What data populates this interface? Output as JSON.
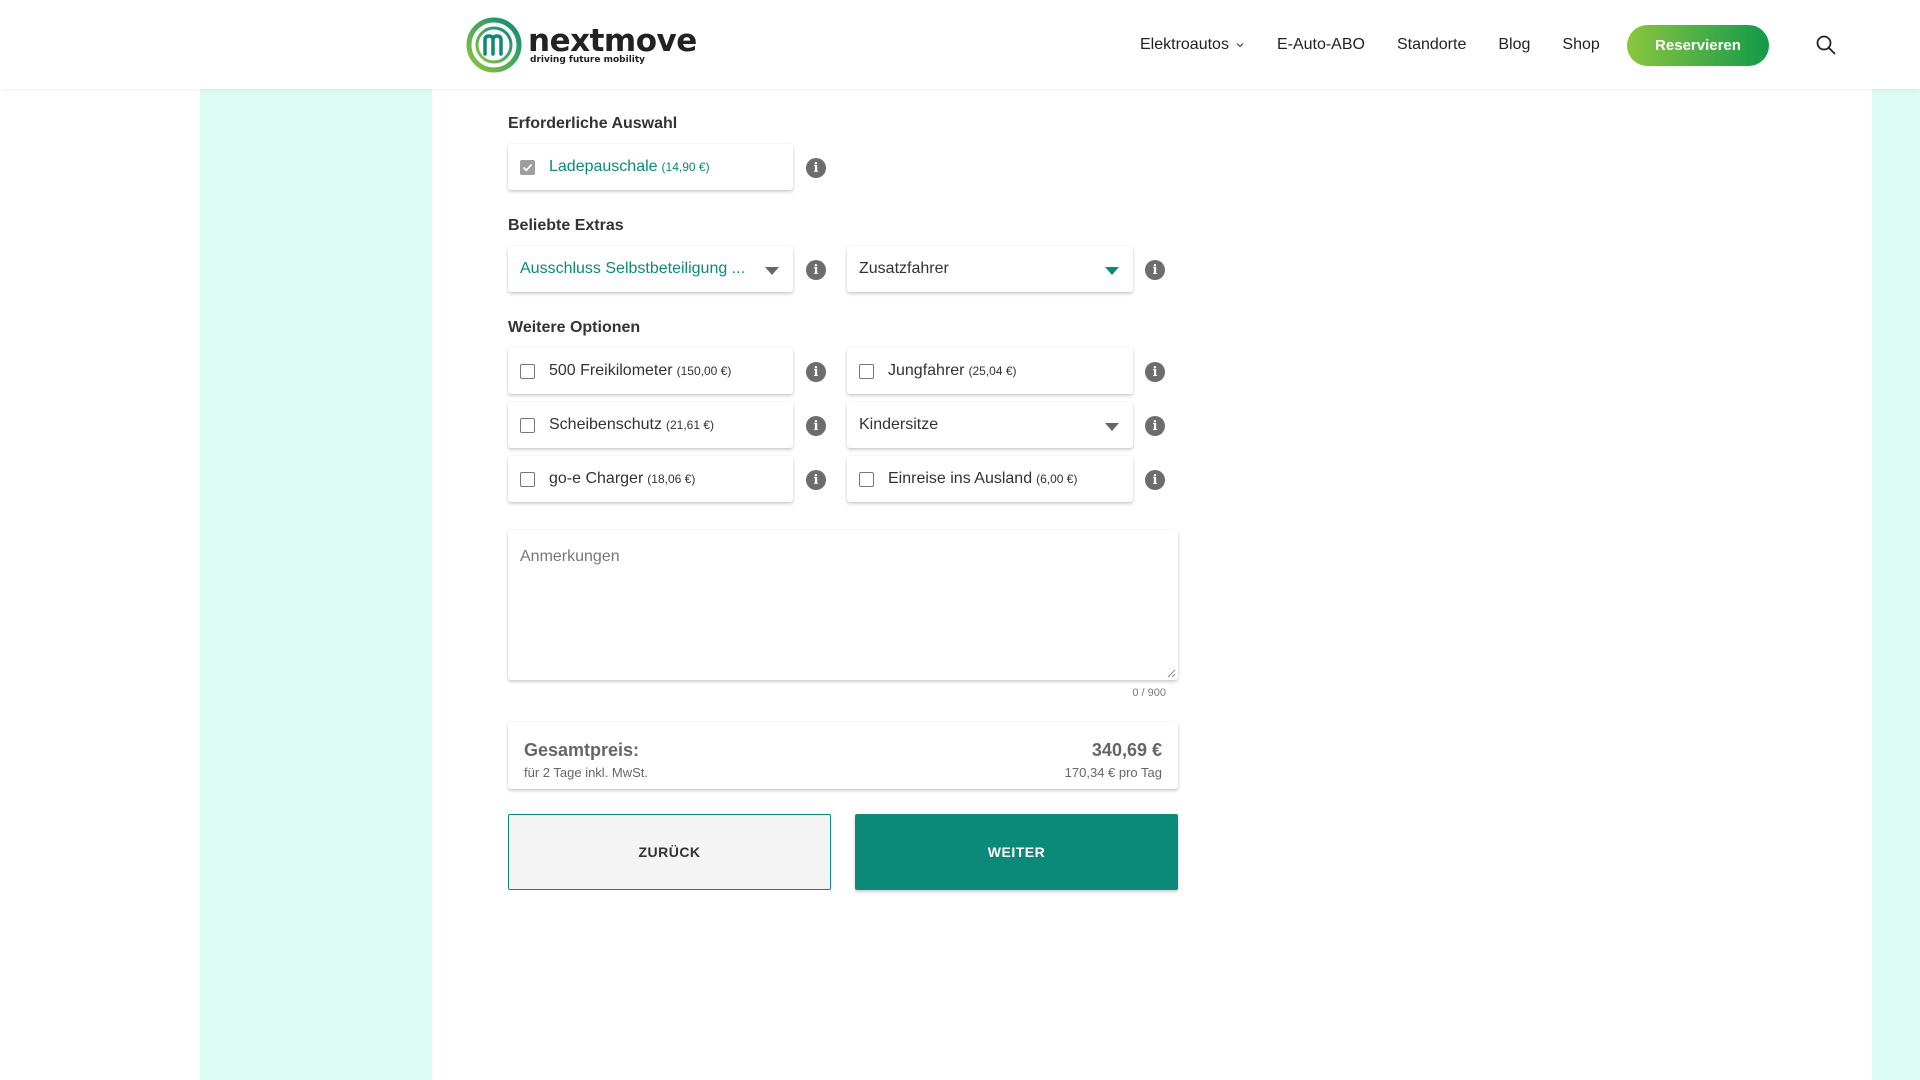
{
  "header": {
    "logo_name": "nextmove",
    "logo_tagline": "driving future mobility",
    "nav": [
      "Elektroautos",
      "E-Auto-ABO",
      "Standorte",
      "Blog",
      "Shop"
    ],
    "reserve_label": "Reservieren"
  },
  "sections": {
    "required": "Erforderliche Auswahl",
    "popular": "Beliebte Extras",
    "more": "Weitere Optionen"
  },
  "required": {
    "ladepauschale": {
      "label": "Ladepauschale",
      "price": "(14,90 €)",
      "checked": true
    }
  },
  "popular": {
    "selbstbeteiligung": "Ausschluss Selbstbeteiligung ...",
    "zusatzfahrer": "Zusatzfahrer"
  },
  "options": {
    "freikilometer": {
      "label": "500 Freikilometer",
      "price": "(150,00 €)"
    },
    "jungfahrer": {
      "label": "Jungfahrer",
      "price": "(25,04 €)"
    },
    "scheibenschutz": {
      "label": "Scheibenschutz",
      "price": "(21,61 €)"
    },
    "kindersitze": "Kindersitze",
    "charger": {
      "label": "go-e Charger",
      "price": "(18,06 €)"
    },
    "ausland": {
      "label": "Einreise ins Ausland",
      "price": "(6,00 €)"
    }
  },
  "remarks": {
    "placeholder": "Anmerkungen",
    "counter": "0 / 900"
  },
  "total": {
    "label": "Gesamtpreis:",
    "sub": "für 2 Tage inkl. MwSt.",
    "amount": "340,69 €",
    "per_day": "170,34 € pro Tag"
  },
  "buttons": {
    "back": "ZURÜCK",
    "next": "WEITER"
  },
  "colors": {
    "accent": "#0b8a79",
    "side_background": "#dcfbf3",
    "reserve_gradient_start": "#8cc63f",
    "reserve_gradient_end": "#119a4a"
  },
  "icons": [
    "nextmove-logo-icon",
    "chevron-down-icon",
    "search-icon",
    "checkmark-icon",
    "info-icon",
    "dropdown-caret-icon",
    "resize-handle-icon"
  ]
}
